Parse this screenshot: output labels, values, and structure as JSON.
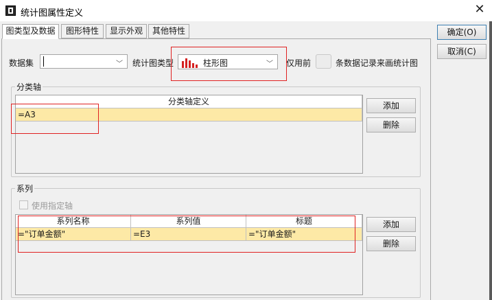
{
  "window": {
    "title": "统计图属性定义",
    "close_glyph": "✕"
  },
  "tabs": [
    {
      "label": "图类型及数据"
    },
    {
      "label": "图形特性"
    },
    {
      "label": "显示外观"
    },
    {
      "label": "其他特性"
    }
  ],
  "buttons": {
    "ok": "确定(O)",
    "cancel": "取消(C)"
  },
  "top_row": {
    "dataset_label": "数据集",
    "dataset_value": "",
    "chart_type_label": "统计图类型",
    "chart_type_value": "柱形图",
    "only_first_label": "仅用前",
    "only_first_value": "",
    "rows_suffix": "条数据记录来画统计图"
  },
  "category_axis": {
    "group_title": "分类轴",
    "column_header": "分类轴定义",
    "rows": [
      "=A3"
    ],
    "add_label": "添加",
    "delete_label": "删除"
  },
  "series": {
    "group_title": "系列",
    "use_axis_label": "使用指定轴",
    "columns": [
      "系列名称",
      "系列值",
      "标题"
    ],
    "rows": [
      [
        "=\"订单金额\"",
        "=E3",
        "=\"订单金额\""
      ]
    ],
    "add_label": "添加",
    "delete_label": "删除"
  },
  "colors": {
    "highlight_row": "#fde9a6",
    "annotation_red": "#e02020",
    "chart_icon_red": "#d42020"
  },
  "icons": {
    "chart_type": "bar-chart-icon",
    "dropdown": "chevron-down-icon",
    "app": "app-icon",
    "close": "close-icon"
  }
}
